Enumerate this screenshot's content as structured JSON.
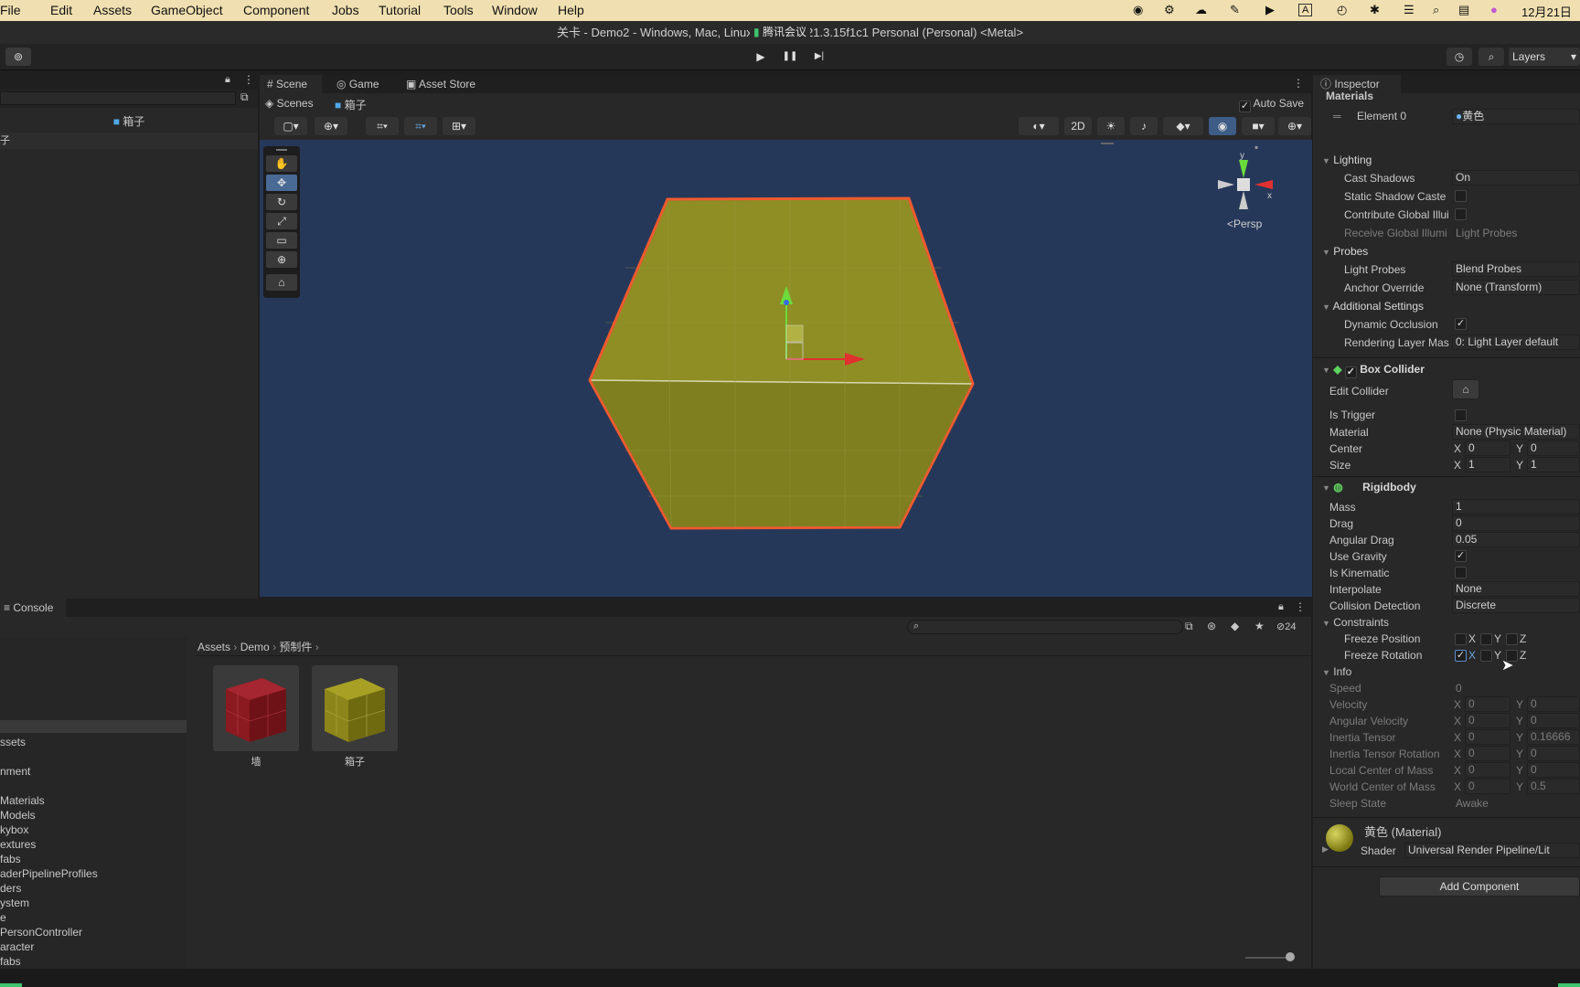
{
  "menubar": {
    "apple": "",
    "items": [
      "File",
      "Edit",
      "Assets",
      "GameObject",
      "Component",
      "Jobs",
      "Tutorial",
      "Tools",
      "Window",
      "Help"
    ],
    "right": [
      "◉",
      "⚙",
      "☁",
      "✎",
      "▶",
      "A",
      "◴",
      "✱",
      "☰",
      "⌕",
      "▤",
      "●",
      "12月21日"
    ],
    "meeting": "腾讯会议"
  },
  "window": {
    "title": "关卡 - Demo2 - Windows, Mac, Linux - Unity 2021.3.15f1c1 Personal (Personal) <Metal>"
  },
  "toolbar": {
    "play": "▶",
    "pause": "❚❚",
    "step": "▶|",
    "layers": "Layers",
    "history_icon": "◷",
    "search_icon": "⌕"
  },
  "hierarchy": {
    "prefab_name": "箱子",
    "left_char": "子"
  },
  "scene": {
    "tabs": [
      "Scene",
      "Game",
      "Asset Store"
    ],
    "breadcrumb_root": "Scenes",
    "breadcrumb_item": "箱子",
    "autosave": "Auto Save",
    "btn_2d": "2D",
    "persp": "<Persp",
    "gizmo_y": "y",
    "gizmo_x": "x"
  },
  "console": {
    "title": "Console",
    "count": "24"
  },
  "project": {
    "breadcrumb": [
      "Assets",
      "Demo",
      "预制件"
    ],
    "assets": [
      {
        "name": "墙",
        "color": "#a11a22"
      },
      {
        "name": "箱子",
        "color": "#a39a14"
      }
    ],
    "tree": [
      "ssets",
      "",
      "nment",
      "",
      "Materials",
      "Models",
      "kybox",
      "extures",
      "fabs",
      "aderPipelineProfiles",
      "ders",
      "ystem",
      "e",
      "PersonController",
      "aracter",
      "fabs"
    ]
  },
  "inspector": {
    "tab": "Inspector",
    "materials": "Materials",
    "element0": "Element 0",
    "element0_val": "黄色",
    "lighting": "Lighting",
    "cast_shadows": "Cast Shadows",
    "cast_shadows_val": "On",
    "static_shadow": "Static Shadow Caste",
    "contribute_gi": "Contribute Global Illui",
    "receive_gi": "Receive Global Illumi",
    "receive_gi_val": "Light Probes",
    "probes": "Probes",
    "light_probes": "Light Probes",
    "light_probes_val": "Blend Probes",
    "anchor_override": "Anchor Override",
    "anchor_override_val": "None (Transform)",
    "additional": "Additional Settings",
    "dynamic_occlusion": "Dynamic Occlusion",
    "rendering_layer": "Rendering Layer Mas",
    "rendering_layer_val": "0: Light Layer default",
    "box_collider": "Box Collider",
    "edit_collider": "Edit Collider",
    "is_trigger": "Is Trigger",
    "material": "Material",
    "material_val": "None (Physic Material)",
    "center": "Center",
    "size": "Size",
    "center_x": "0",
    "center_y": "0",
    "size_x": "1",
    "size_y": "1",
    "rigidbody": "Rigidbody",
    "mass": "Mass",
    "mass_val": "1",
    "drag": "Drag",
    "drag_val": "0",
    "angular_drag": "Angular Drag",
    "angular_drag_val": "0.05",
    "use_gravity": "Use Gravity",
    "is_kinematic": "Is Kinematic",
    "interpolate": "Interpolate",
    "interpolate_val": "None",
    "collision_detection": "Collision Detection",
    "collision_detection_val": "Discrete",
    "constraints": "Constraints",
    "freeze_position": "Freeze Position",
    "freeze_rotation": "Freeze Rotation",
    "x": "X",
    "y": "Y",
    "z": "Z",
    "info": "Info",
    "speed": "Speed",
    "speed_val": "0",
    "velocity": "Velocity",
    "angular_velocity": "Angular Velocity",
    "inertia_tensor": "Inertia Tensor",
    "inertia_tensor_rotation": "Inertia Tensor Rotation",
    "local_com": "Local Center of Mass",
    "world_com": "World Center of Mass",
    "sleep_state": "Sleep State",
    "sleep_state_val": "Awake",
    "zero": "0",
    "inertia_y": "0.16666",
    "world_com_y": "0.5",
    "mat_name": "黄色 (Material)",
    "shader": "Shader",
    "shader_val": "Universal Render Pipeline/Lit",
    "add_component": "Add Component"
  }
}
